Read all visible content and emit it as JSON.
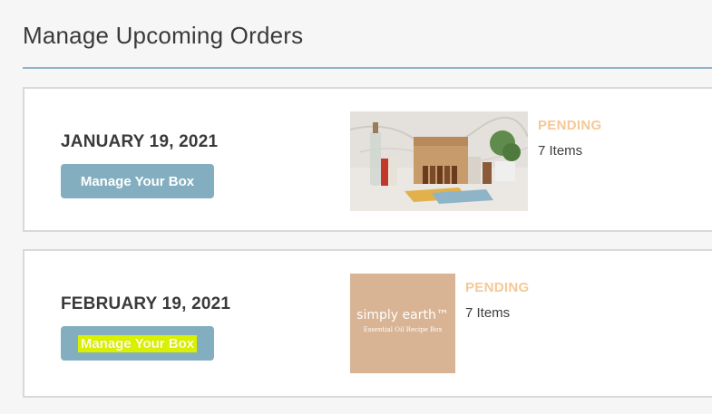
{
  "page": {
    "title": "Manage Upcoming Orders"
  },
  "orders": [
    {
      "date": "JANUARY 19, 2021",
      "button_label": "Manage Your Box",
      "status": "PENDING",
      "items": "7 Items",
      "image": "essential-oil-kit-photo"
    },
    {
      "date": "FEBRUARY 19, 2021",
      "button_label": "Manage Your Box",
      "status": "PENDING",
      "items": "7 Items",
      "image": "simply-earth-box-logo",
      "image_brand": "simply earth™",
      "image_sub": "Essential Oil Recipe Box"
    }
  ],
  "colors": {
    "accent_rule": "#8fb4c8",
    "button_bg": "#83aebf",
    "status_pending": "#f5c896",
    "highlight": "#d9f000"
  }
}
